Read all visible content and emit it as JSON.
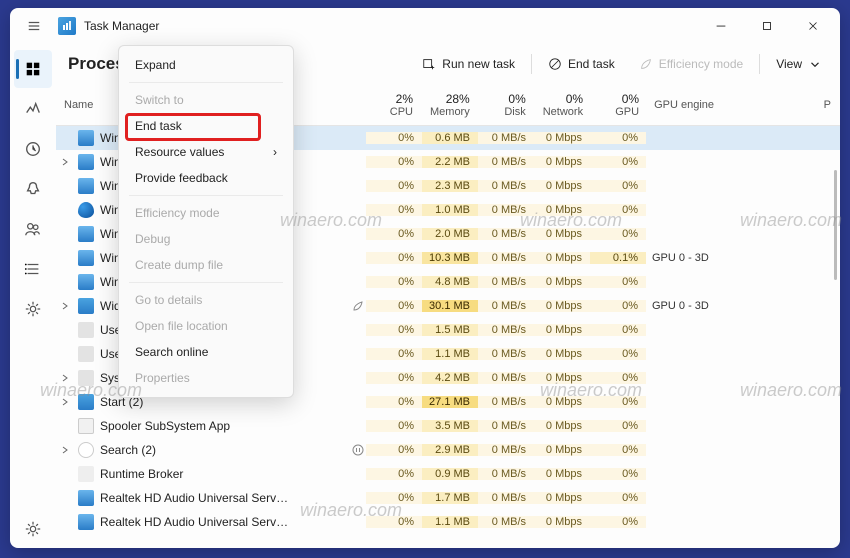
{
  "app": {
    "title": "Task Manager"
  },
  "toolbar": {
    "page_title": "Processes",
    "run_new": "Run new task",
    "end_task": "End task",
    "eff_mode": "Efficiency mode",
    "view": "View"
  },
  "columns": {
    "name": "Name",
    "cpu_pct": "2%",
    "cpu": "CPU",
    "mem_pct": "28%",
    "mem": "Memory",
    "disk_pct": "0%",
    "disk": "Disk",
    "net_pct": "0%",
    "net": "Network",
    "gpu_pct": "0%",
    "gpu": "GPU",
    "gpu_engine": "GPU engine",
    "p": "P"
  },
  "context_menu": {
    "expand": "Expand",
    "switch_to": "Switch to",
    "end_task": "End task",
    "resource_values": "Resource values",
    "provide_feedback": "Provide feedback",
    "efficiency_mode": "Efficiency mode",
    "debug": "Debug",
    "create_dump": "Create dump file",
    "go_to_details": "Go to details",
    "open_file_loc": "Open file location",
    "search_online": "Search online",
    "properties": "Properties"
  },
  "rows": [
    {
      "n": "Winc",
      "exp": false,
      "sel": true,
      "ic": "ic-blue",
      "cpu": "0%",
      "mem": "0.6 MB",
      "disk": "0 MB/s",
      "net": "0 Mbps",
      "gpu": "0%",
      "gpue": ""
    },
    {
      "n": "Winc",
      "exp": true,
      "ic": "ic-blue",
      "cpu": "0%",
      "mem": "2.2 MB",
      "disk": "0 MB/s",
      "net": "0 Mbps",
      "gpu": "0%",
      "gpue": ""
    },
    {
      "n": "Winc",
      "exp": false,
      "ic": "ic-blue",
      "cpu": "0%",
      "mem": "2.3 MB",
      "disk": "0 MB/s",
      "net": "0 Mbps",
      "gpu": "0%",
      "gpue": ""
    },
    {
      "n": "Winc",
      "exp": false,
      "ic": "ic-shield",
      "cpu": "0%",
      "mem": "1.0 MB",
      "disk": "0 MB/s",
      "net": "0 Mbps",
      "gpu": "0%",
      "gpue": ""
    },
    {
      "n": "Winc",
      "exp": false,
      "ic": "ic-blue",
      "cpu": "0%",
      "mem": "2.0 MB",
      "disk": "0 MB/s",
      "net": "0 Mbps",
      "gpu": "0%",
      "gpue": ""
    },
    {
      "n": "Winc",
      "exp": false,
      "ic": "ic-blue",
      "cpu": "0%",
      "mem": "10.3 MB",
      "disk": "0 MB/s",
      "net": "0 Mbps",
      "gpu": "0.1%",
      "gpue": "GPU 0 - 3D"
    },
    {
      "n": "Winc",
      "exp": false,
      "ic": "ic-blue",
      "cpu": "0%",
      "mem": "4.8 MB",
      "disk": "0 MB/s",
      "net": "0 Mbps",
      "gpu": "0%",
      "gpue": ""
    },
    {
      "n": "Widg",
      "exp": true,
      "ic": "ic-widget",
      "status": "leaf",
      "cpu": "0%",
      "mem": "30.1 MB",
      "disk": "0 MB/s",
      "net": "0 Mbps",
      "gpu": "0%",
      "gpue": "GPU 0 - 3D"
    },
    {
      "n": "User",
      "exp": false,
      "ic": "ic-user",
      "cpu": "0%",
      "mem": "1.5 MB",
      "disk": "0 MB/s",
      "net": "0 Mbps",
      "gpu": "0%",
      "gpue": ""
    },
    {
      "n": "User",
      "exp": false,
      "ic": "ic-user",
      "cpu": "0%",
      "mem": "1.1 MB",
      "disk": "0 MB/s",
      "net": "0 Mbps",
      "gpu": "0%",
      "gpue": ""
    },
    {
      "n": "Syste",
      "exp": true,
      "ic": "ic-sys",
      "cpu": "0%",
      "mem": "4.2 MB",
      "disk": "0 MB/s",
      "net": "0 Mbps",
      "gpu": "0%",
      "gpue": ""
    },
    {
      "n": "Start (2)",
      "exp": true,
      "ic": "ic-start",
      "cpu": "0%",
      "mem": "27.1 MB",
      "disk": "0 MB/s",
      "net": "0 Mbps",
      "gpu": "0%",
      "gpue": ""
    },
    {
      "n": "Spooler SubSystem App",
      "exp": false,
      "ic": "ic-print",
      "cpu": "0%",
      "mem": "3.5 MB",
      "disk": "0 MB/s",
      "net": "0 Mbps",
      "gpu": "0%",
      "gpue": ""
    },
    {
      "n": "Search (2)",
      "exp": true,
      "ic": "ic-search",
      "status": "pause",
      "cpu": "0%",
      "mem": "2.9 MB",
      "disk": "0 MB/s",
      "net": "0 Mbps",
      "gpu": "0%",
      "gpue": ""
    },
    {
      "n": "Runtime Broker",
      "exp": false,
      "ic": "ic-run",
      "cpu": "0%",
      "mem": "0.9 MB",
      "disk": "0 MB/s",
      "net": "0 Mbps",
      "gpu": "0%",
      "gpue": ""
    },
    {
      "n": "Realtek HD Audio Universal Serv…",
      "exp": false,
      "ic": "ic-audio",
      "cpu": "0%",
      "mem": "1.7 MB",
      "disk": "0 MB/s",
      "net": "0 Mbps",
      "gpu": "0%",
      "gpue": ""
    },
    {
      "n": "Realtek HD Audio Universal Serv…",
      "exp": false,
      "ic": "ic-audio",
      "cpu": "0%",
      "mem": "1.1 MB",
      "disk": "0 MB/s",
      "net": "0 Mbps",
      "gpu": "0%",
      "gpue": ""
    }
  ],
  "heat": {
    "cpu_col": "h1",
    "mem_col": "h2"
  },
  "watermark": "winaero.com"
}
